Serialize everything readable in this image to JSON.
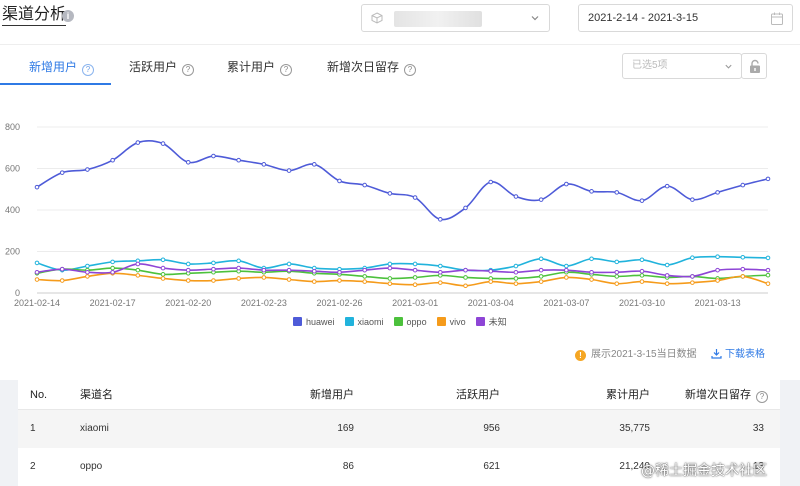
{
  "header": {
    "title": "渠道分析",
    "app_selector": {
      "icon": "cube-icon"
    },
    "date_range": "2021-2-14 - 2021-3-15"
  },
  "tabs": [
    {
      "label": "新增用户",
      "active": true
    },
    {
      "label": "活跃用户",
      "active": false
    },
    {
      "label": "累计用户",
      "active": false
    },
    {
      "label": "新增次日留存",
      "active": false
    }
  ],
  "channel_filter": {
    "placeholder": "已选5项"
  },
  "chart_data": {
    "type": "line",
    "x": [
      "2021-02-14",
      "2021-02-15",
      "2021-02-16",
      "2021-02-17",
      "2021-02-18",
      "2021-02-19",
      "2021-02-20",
      "2021-02-21",
      "2021-02-22",
      "2021-02-23",
      "2021-02-24",
      "2021-02-25",
      "2021-02-26",
      "2021-02-27",
      "2021-02-28",
      "2021-03-01",
      "2021-03-02",
      "2021-03-03",
      "2021-03-04",
      "2021-03-05",
      "2021-03-06",
      "2021-03-07",
      "2021-03-08",
      "2021-03-09",
      "2021-03-10",
      "2021-03-11",
      "2021-03-12",
      "2021-03-13",
      "2021-03-14",
      "2021-03-15"
    ],
    "x_tick_labels": [
      "2021-02-14",
      "2021-02-17",
      "2021-02-20",
      "2021-02-23",
      "2021-02-26",
      "2021-03-01",
      "2021-03-04",
      "2021-03-07",
      "2021-03-10",
      "2021-03-13"
    ],
    "ylim": [
      0,
      800
    ],
    "yticks": [
      0,
      200,
      400,
      600,
      800
    ],
    "grid": true,
    "legend_position": "bottom",
    "series": [
      {
        "name": "huawei",
        "color": "#4e5bd8",
        "values": [
          510,
          580,
          595,
          640,
          725,
          720,
          630,
          660,
          640,
          620,
          590,
          620,
          540,
          520,
          480,
          460,
          355,
          410,
          535,
          465,
          450,
          525,
          490,
          485,
          445,
          515,
          450,
          485,
          520,
          550
        ]
      },
      {
        "name": "xiaomi",
        "color": "#21b3dc",
        "values": [
          145,
          110,
          130,
          150,
          155,
          160,
          140,
          145,
          155,
          120,
          140,
          120,
          115,
          120,
          140,
          140,
          130,
          110,
          110,
          130,
          165,
          130,
          165,
          150,
          160,
          135,
          170,
          175,
          172,
          169
        ]
      },
      {
        "name": "oppo",
        "color": "#4cc13c",
        "values": [
          95,
          115,
          110,
          120,
          110,
          90,
          95,
          100,
          105,
          100,
          105,
          95,
          90,
          80,
          70,
          75,
          85,
          75,
          70,
          70,
          80,
          100,
          90,
          80,
          85,
          75,
          80,
          70,
          80,
          86
        ]
      },
      {
        "name": "vivo",
        "color": "#f59b1b",
        "values": [
          65,
          60,
          80,
          95,
          85,
          70,
          60,
          60,
          70,
          75,
          65,
          55,
          60,
          55,
          45,
          40,
          50,
          35,
          55,
          45,
          55,
          75,
          65,
          45,
          55,
          45,
          50,
          60,
          80,
          45
        ]
      },
      {
        "name": "未知",
        "color": "#8e45d6",
        "values": [
          100,
          115,
          100,
          100,
          140,
          120,
          110,
          115,
          120,
          110,
          110,
          105,
          100,
          110,
          120,
          110,
          100,
          110,
          105,
          100,
          110,
          110,
          100,
          100,
          105,
          85,
          80,
          110,
          115,
          110
        ]
      }
    ]
  },
  "footer_note": "展示2021-3-15当日数据",
  "download_label": "下载表格",
  "table": {
    "headers": {
      "no": "No.",
      "channel": "渠道名",
      "new_users": "新增用户",
      "active_users": "活跃用户",
      "total_users": "累计用户",
      "retention": "新增次日留存"
    },
    "rows": [
      {
        "no": "1",
        "channel": "xiaomi",
        "new_users": "169",
        "active_users": "956",
        "total_users": "35,775",
        "retention": "33"
      },
      {
        "no": "2",
        "channel": "oppo",
        "new_users": "86",
        "active_users": "621",
        "total_users": "21,240",
        "retention": "13"
      }
    ]
  },
  "watermark": "@稀土掘金技术社区"
}
